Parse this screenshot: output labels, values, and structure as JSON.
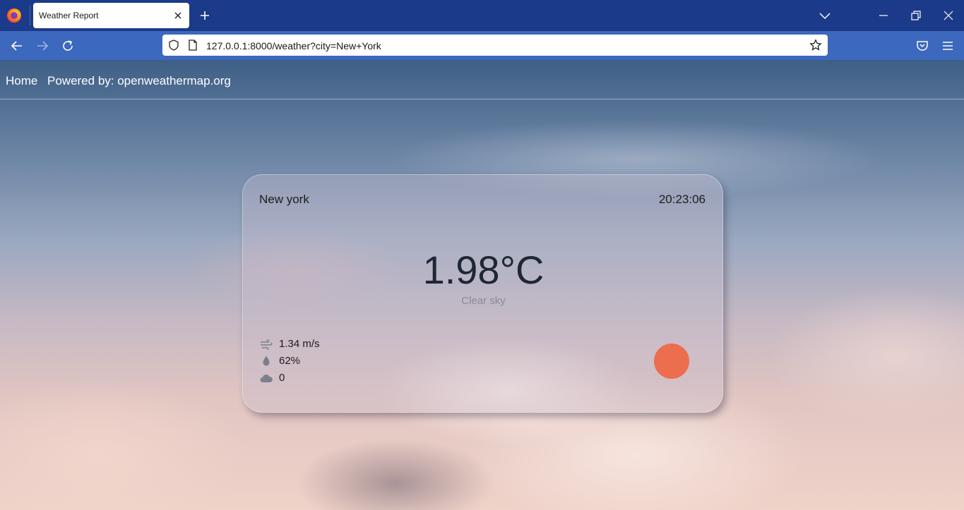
{
  "browser": {
    "tab_title": "Weather Report",
    "url": "127.0.0.1:8000/weather?city=New+York"
  },
  "site_nav": {
    "home": "Home",
    "powered_by": "Powered by: openweathermap.org"
  },
  "weather": {
    "city": "New york",
    "time": "20:23:06",
    "temperature": "1.98°C",
    "description": "Clear sky",
    "wind": "1.34 m/s",
    "humidity": "62%",
    "clouds": "0",
    "sun_color": "#ec6e4e"
  },
  "icons": {
    "wind": "wind-icon",
    "humidity": "droplet-icon",
    "clouds": "cloud-icon",
    "condition": "sun-icon"
  }
}
